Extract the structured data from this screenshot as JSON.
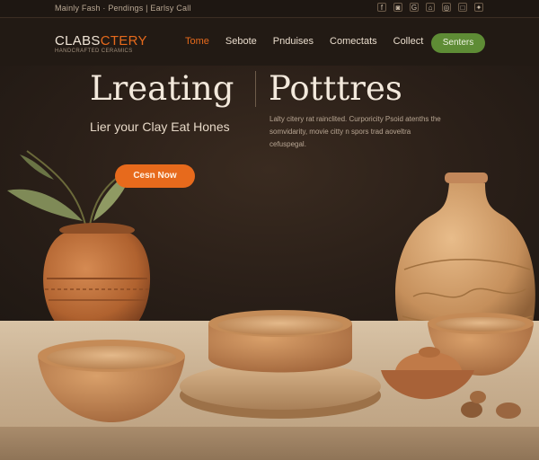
{
  "topbar": {
    "info_text": "Mainly Fash · Pendings | Earlsy Call",
    "social_icons": [
      "facebook-icon",
      "instagram-icon",
      "google-icon",
      "chat-icon",
      "pinterest-icon",
      "camera-icon",
      "twitter-icon"
    ],
    "social_glyphs": [
      "f",
      "◙",
      "G",
      "⌂",
      "◎",
      "□",
      "✦"
    ]
  },
  "header": {
    "logo_main": "CLABS",
    "logo_accent": "CTERY",
    "logo_sub": "HANDCRAFTED CERAMICS",
    "nav": [
      "Tome",
      "Sebote",
      "Pnduises",
      "Comectats",
      "Collect"
    ],
    "cta_label": "Senters"
  },
  "hero": {
    "title_left": "Lreating",
    "title_right": "Potttres",
    "subtitle": "Lier your Clay Eat Hones",
    "paragraph": "Lalty citery rat rainclited. Curporicity Psoid atenths the somvidarity, movie citty n spors trad aoveltra cefuspegal.",
    "button_label": "Cesn Now"
  },
  "colors": {
    "accent": "#e76a1c",
    "cta_green": "#5e8c35",
    "background": "#241b15",
    "clay": "#c07a48"
  }
}
